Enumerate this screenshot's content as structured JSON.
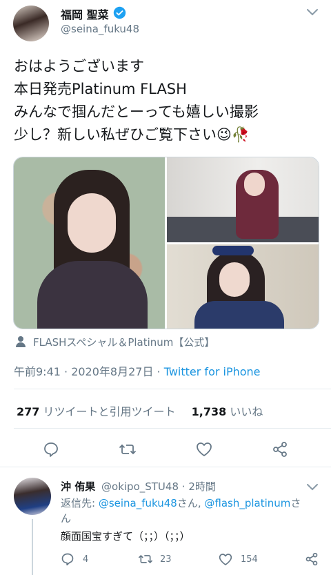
{
  "tweet": {
    "author_name": "福岡 聖菜",
    "author_handle": "@seina_fuku48",
    "text_lines": [
      "おはようございます",
      "本日発売Platinum FLASH",
      "みんなで掴んだとーっても嬉しい撮影",
      "少し？新しい私ぜひご覧下さい😉🥀"
    ],
    "tagged": "FLASHスペシャル＆Platinum【公式】",
    "time": "午前9:41 · 2020年8月27日 · ",
    "source": "Twitter for iPhone",
    "retweets_count": "277",
    "retweets_label": "リツイートと引用ツイート",
    "likes_count": "1,738",
    "likes_label": "いいね"
  },
  "reply": {
    "author_name": "沖 侑果",
    "author_handle": "@okipo_STU48",
    "time": "· 2時間",
    "replying_prefix": "返信先: ",
    "mention1": "@seina_fuku48",
    "joiner": "さん, ",
    "mention2": "@flash_platinum",
    "suffix1": "さ",
    "suffix2": "ん",
    "text": "顔面国宝すぎて（；；）（；；）",
    "reply_count": "4",
    "retweet_count": "23",
    "like_count": "154"
  },
  "colors": {
    "accent": "#1b95e0",
    "muted": "#657786",
    "divider": "#e6ecf0"
  }
}
